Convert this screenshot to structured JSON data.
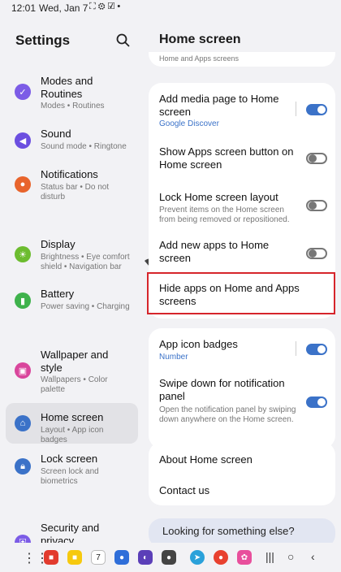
{
  "status_bar": {
    "time": "12:01",
    "date": "Wed, Jan 7",
    "icons": [
      "screenshot-icon",
      "settings-icon",
      "check-icon",
      "dot-icon"
    ],
    "wifi": "wifi-icon",
    "battery": "100"
  },
  "left_pane": {
    "title": "Settings",
    "items": [
      {
        "label": "Modes and Routines",
        "sub": "Modes • Routines",
        "icon": "modes-icon",
        "color": "#7c5ce6"
      },
      {
        "label": "Sound",
        "sub": "Sound mode • Ringtone",
        "icon": "sound-icon",
        "color": "#6c4fe0"
      },
      {
        "label": "Notifications",
        "sub": "Status bar • Do not disturb",
        "icon": "notifications-icon",
        "color": "#e8642c"
      },
      {
        "label": "Display",
        "sub": "Brightness • Eye comfort shield • Navigation bar",
        "icon": "display-icon",
        "color": "#6cbc2f"
      },
      {
        "label": "Battery",
        "sub": "Power saving • Charging",
        "icon": "battery-icon",
        "color": "#3fb24c"
      },
      {
        "label": "Wallpaper and style",
        "sub": "Wallpapers • Color palette",
        "icon": "wallpaper-icon",
        "color": "#d9469c"
      },
      {
        "label": "Home screen",
        "sub": "Layout • App icon badges",
        "icon": "home-icon",
        "color": "#3b72c8"
      },
      {
        "label": "Lock screen",
        "sub": "Screen lock and biometrics",
        "icon": "lock-icon",
        "color": "#3b72c8"
      },
      {
        "label": "Security and privacy",
        "sub": "",
        "icon": "security-icon",
        "color": "#7c5ce6"
      }
    ]
  },
  "right_pane": {
    "title": "Home screen",
    "top_partial": "Home and Apps screens",
    "card1": [
      {
        "label": "Add media page to Home screen",
        "sub": "Google Discover",
        "toggle": "on"
      },
      {
        "label": "Show Apps screen button on Home screen",
        "sub": "",
        "toggle": "off"
      },
      {
        "label": "Lock Home screen layout",
        "sub": "Prevent items on the Home screen from being removed or repositioned.",
        "toggle": "off"
      },
      {
        "label": "Add new apps to Home screen",
        "sub": "",
        "toggle": "off"
      },
      {
        "label": "Hide apps on Home and Apps screens",
        "sub": "",
        "toggle": ""
      }
    ],
    "card2": [
      {
        "label": "App icon badges",
        "sub": "Number",
        "toggle": "on"
      },
      {
        "label": "Swipe down for notification panel",
        "sub": "Open the notification panel by swiping down anywhere on the Home screen.",
        "toggle": "on"
      }
    ],
    "card3": [
      {
        "label": "About Home screen"
      },
      {
        "label": "Contact us"
      }
    ],
    "looking": "Looking for something else?"
  },
  "taskbar": {
    "apps": [
      "apps-grid-icon",
      "app-red-icon",
      "app-yellow-icon",
      "calendar-icon",
      "messages-icon",
      "app-purple-icon",
      "camera-icon",
      "telegram-icon",
      "chrome-icon",
      "flower-icon"
    ],
    "calendar_day": "7",
    "nav": [
      "recents-icon",
      "home-nav-icon",
      "back-icon"
    ]
  },
  "colors": {
    "accent": "#3b72c8",
    "highlight_border": "#d6252b",
    "background": "#f2f2f5"
  }
}
